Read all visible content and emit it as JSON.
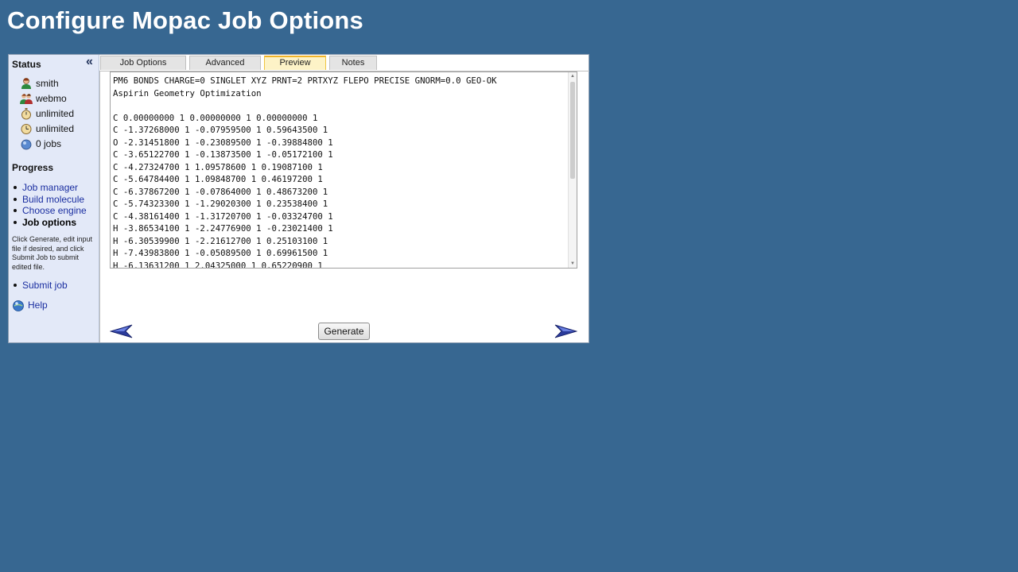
{
  "title": "Configure Mopac Job Options",
  "sidebar": {
    "collapse_glyph": "«",
    "status_heading": "Status",
    "status_items": [
      {
        "icon": "user-icon",
        "label": "smith"
      },
      {
        "icon": "group-icon",
        "label": "webmo"
      },
      {
        "icon": "stopwatch-icon",
        "label": "unlimited"
      },
      {
        "icon": "clock-icon",
        "label": "unlimited"
      },
      {
        "icon": "jobs-icon",
        "label": "0 jobs"
      }
    ],
    "progress_heading": "Progress",
    "progress_items": [
      {
        "label": "Job manager",
        "current": false
      },
      {
        "label": "Build molecule",
        "current": false
      },
      {
        "label": "Choose engine",
        "current": false
      },
      {
        "label": "Job options",
        "current": true
      }
    ],
    "instructions": "Click Generate, edit input file if desired, and click Submit Job to submit edited file.",
    "submit_label": "Submit job",
    "help_label": "Help"
  },
  "tabs": [
    {
      "label": "Job Options",
      "active": false
    },
    {
      "label": "Advanced",
      "active": false
    },
    {
      "label": "Preview",
      "active": true
    },
    {
      "label": "Notes",
      "active": false
    }
  ],
  "preview": {
    "lines": [
      "PM6 BONDS CHARGE=0 SINGLET XYZ PRNT=2 PRTXYZ FLEPO PRECISE GNORM=0.0 GEO-OK",
      "Aspirin Geometry Optimization",
      "",
      "C 0.00000000 1 0.00000000 1 0.00000000 1",
      "C -1.37268000 1 -0.07959500 1 0.59643500 1",
      "O -2.31451800 1 -0.23089500 1 -0.39884800 1",
      "C -3.65122700 1 -0.13873500 1 -0.05172100 1",
      "C -4.27324700 1 1.09578600 1 0.19087100 1",
      "C -5.64784400 1 1.09848700 1 0.46197200 1",
      "C -6.37867200 1 -0.07864000 1 0.48673200 1",
      "C -5.74323300 1 -1.29020300 1 0.23538400 1",
      "C -4.38161400 1 -1.31720700 1 -0.03324700 1",
      "H -3.86534100 1 -2.24776900 1 -0.23021400 1",
      "H -6.30539900 1 -2.21612700 1 0.25103100 1",
      "H -7.43983800 1 -0.05089500 1 0.69961500 1",
      "H -6.13631200 1 2.04325000 1 0.65220900 1"
    ]
  },
  "buttons": {
    "generate": "Generate",
    "back_icon": "back-arrow-icon",
    "next_icon": "next-arrow-icon"
  },
  "colors": {
    "background": "#376791",
    "sidebar": "#e3e9f8",
    "link": "#1a2ea0",
    "active_tab": "#fdf3c7"
  }
}
